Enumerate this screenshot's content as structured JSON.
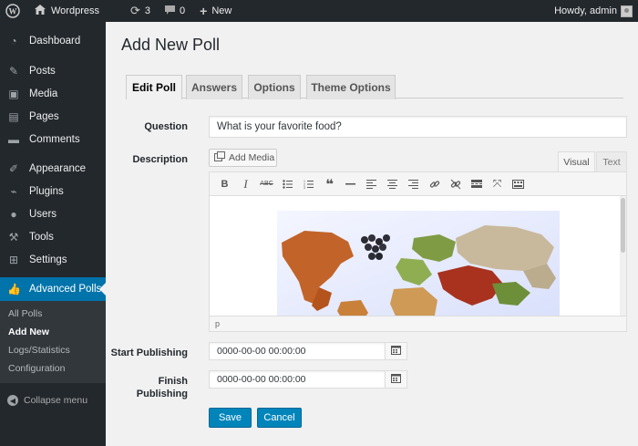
{
  "adminbar": {
    "site_name": "Wordpress",
    "updates_count": "3",
    "comments_count": "0",
    "new_label": "New",
    "greeting": "Howdy, admin"
  },
  "sidebar": {
    "items": [
      {
        "label": "Dashboard",
        "icon": "dashboard-icon"
      },
      {
        "label": "Posts",
        "icon": "pin-icon"
      },
      {
        "label": "Media",
        "icon": "media-icon"
      },
      {
        "label": "Pages",
        "icon": "pages-icon"
      },
      {
        "label": "Comments",
        "icon": "comment-icon"
      },
      {
        "label": "Appearance",
        "icon": "brush-icon"
      },
      {
        "label": "Plugins",
        "icon": "plugin-icon"
      },
      {
        "label": "Users",
        "icon": "user-icon"
      },
      {
        "label": "Tools",
        "icon": "wrench-icon"
      },
      {
        "label": "Settings",
        "icon": "settings-icon"
      },
      {
        "label": "Advanced Polls",
        "icon": "thumbs-up-icon"
      }
    ],
    "submenu": [
      "All Polls",
      "Add New",
      "Logs/Statistics",
      "Configuration"
    ],
    "collapse_label": "Collapse menu"
  },
  "main": {
    "title": "Add New Poll",
    "tabs": [
      "Edit Poll",
      "Answers",
      "Options",
      "Theme Options"
    ],
    "question_label": "Question",
    "question_value": "What is your favorite food?",
    "description_label": "Description",
    "add_media_label": "Add Media",
    "editor_tabs": [
      "Visual",
      "Text"
    ],
    "editor_path": "p",
    "start_label": "Start Publishing",
    "start_value": "0000-00-00 00:00:00",
    "finish_label_1": "Finish",
    "finish_label_2": "Publishing",
    "finish_value": "0000-00-00 00:00:00",
    "save_label": "Save",
    "cancel_label": "Cancel"
  },
  "colors": {
    "adminbar": "#23282d",
    "accent": "#0073aa",
    "button": "#0085ba"
  }
}
